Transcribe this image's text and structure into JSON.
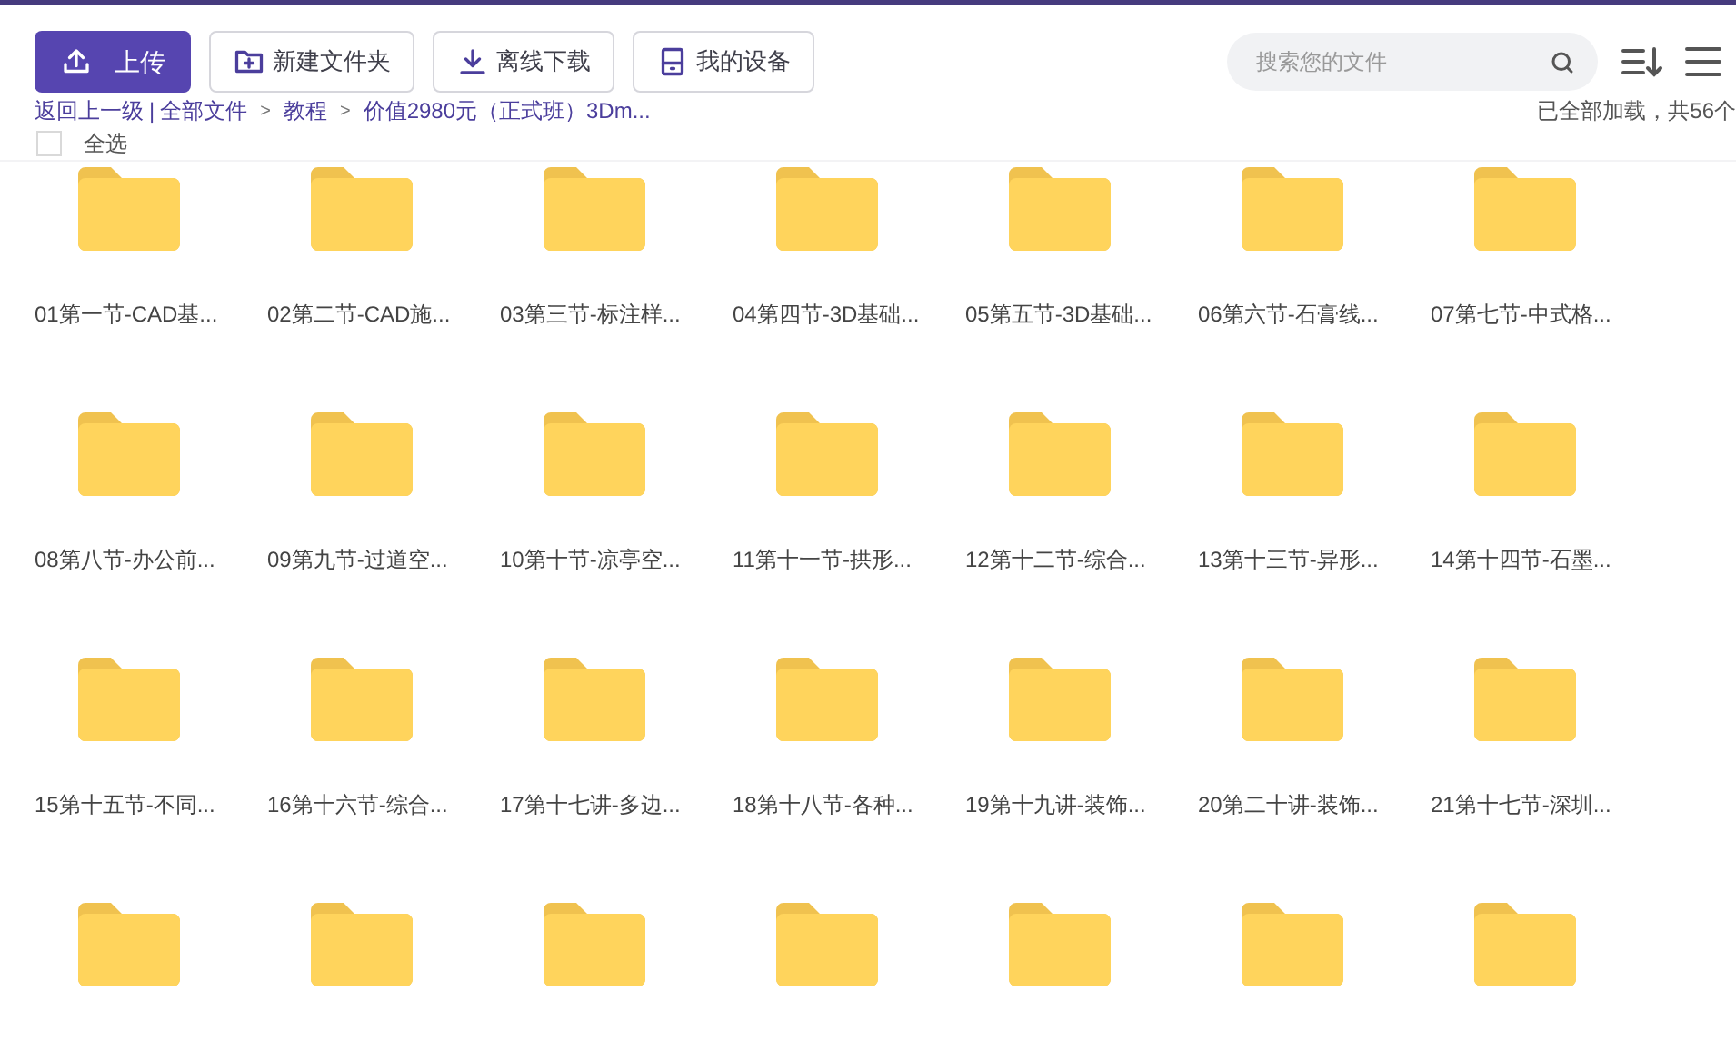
{
  "toolbar": {
    "buttons": [
      {
        "kind": "primary",
        "label": "上传"
      },
      {
        "kind": "outline",
        "label": "新建文件夹"
      },
      {
        "kind": "outline",
        "label": "离线下载"
      },
      {
        "kind": "outline",
        "label": "我的设备"
      }
    ],
    "search": {
      "placeholder": "搜索您的文件"
    }
  },
  "breadcrumb": {
    "back": "返回上一级",
    "divider": "|",
    "items": [
      {
        "label": "全部文件"
      },
      {
        "arrow": ">",
        "label": "教程"
      },
      {
        "arrow": ">",
        "label": "价值2980元（正式班）3Dm..."
      }
    ]
  },
  "status": "已全部加载，共56个",
  "select_all": {
    "label": "全选",
    "checked": false
  },
  "folders": [
    {
      "name": "01第一节-CAD基..."
    },
    {
      "name": "02第二节-CAD施..."
    },
    {
      "name": "03第三节-标注样..."
    },
    {
      "name": "04第四节-3D基础..."
    },
    {
      "name": "05第五节-3D基础..."
    },
    {
      "name": "06第六节-石膏线..."
    },
    {
      "name": "07第七节-中式格..."
    },
    {
      "name": "08第八节-办公前..."
    },
    {
      "name": "09第九节-过道空..."
    },
    {
      "name": "10第十节-凉亭空..."
    },
    {
      "name": "11第十一节-拱形..."
    },
    {
      "name": "12第十二节-综合..."
    },
    {
      "name": "13第十三节-异形..."
    },
    {
      "name": "14第十四节-石墨..."
    },
    {
      "name": "15第十五节-不同..."
    },
    {
      "name": "16第十六节-综合..."
    },
    {
      "name": "17第十七讲-多边..."
    },
    {
      "name": "18第十八节-各种..."
    },
    {
      "name": "19第十九讲-装饰..."
    },
    {
      "name": "20第二十讲-装饰..."
    },
    {
      "name": "21第十七节-深圳..."
    },
    {
      "kind": "folder"
    },
    {
      "kind": "folder"
    },
    {
      "kind": "folder"
    },
    {
      "kind": "folder"
    },
    {
      "kind": "folder"
    },
    {
      "kind": "folder"
    },
    {
      "kind": "folder"
    }
  ]
}
